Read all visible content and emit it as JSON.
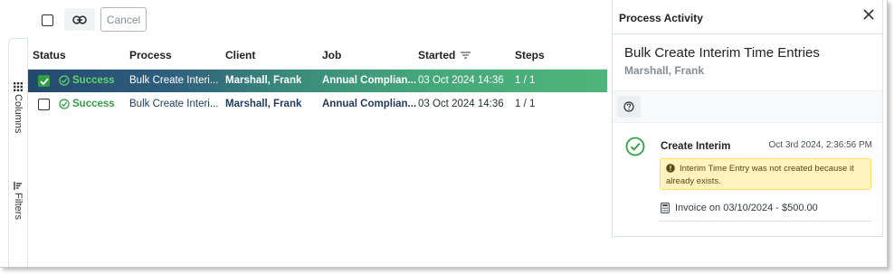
{
  "toolbar": {
    "select_all": false,
    "link_icon": "link-icon",
    "cancel_label": "Cancel"
  },
  "rail": {
    "columns_label": "Columns",
    "filters_label": "Filters",
    "columns_icon": "grid-icon",
    "filters_icon": "filter-icon"
  },
  "grid": {
    "columns": [
      "Status",
      "Process",
      "Client",
      "Job",
      "Started",
      "Steps"
    ],
    "sort_icon": "sort-icon",
    "rows": [
      {
        "selected": true,
        "status": "Success",
        "process": "Bulk Create Interi...",
        "client": "Marshall, Frank",
        "job": "Annual Complian...",
        "started": "03 Oct 2024 14:36",
        "steps": "1 / 1"
      },
      {
        "selected": false,
        "status": "Success",
        "process": "Bulk Create Interi...",
        "client": "Marshall, Frank",
        "job": "Annual Complian...",
        "started": "03 Oct 2024 14:36",
        "steps": "1 / 1"
      }
    ]
  },
  "panel": {
    "title": "Process Activity",
    "entry_title": "Bulk Create Interim Time Entries",
    "entry_subtitle": "Marshall, Frank",
    "help_icon": "question-icon",
    "activity": {
      "title": "Create Interim",
      "timestamp": "Oct 3rd 2024, 2:36:56 PM",
      "warning": "Interim Time Entry was not created because it already exists.",
      "invoice": "Invoice on 03/10/2024 - $500.00"
    }
  },
  "colors": {
    "success": "#2f9e44",
    "selected_row_start": "#24496e",
    "selected_row_end": "#4fb57a",
    "warning_bg": "#fff3bf"
  }
}
